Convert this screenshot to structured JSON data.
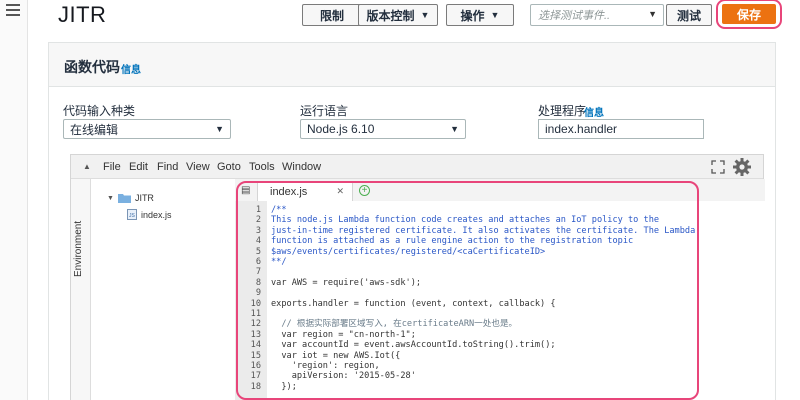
{
  "header": {
    "title": "JITR",
    "throttle_label": "限制",
    "version_label": "版本控制",
    "actions_label": "操作",
    "test_placeholder": "选择测试事件..",
    "test_label": "测试",
    "save_label": "保存"
  },
  "panel": {
    "title": "函数代码",
    "info": "信息",
    "code_entry": {
      "label": "代码输入种类",
      "value": "在线编辑"
    },
    "runtime": {
      "label": "运行语言",
      "value": "Node.js 6.10"
    },
    "handler": {
      "label": "处理程序",
      "info": "信息",
      "value": "index.handler"
    }
  },
  "ide": {
    "menu": [
      "File",
      "Edit",
      "Find",
      "View",
      "Goto",
      "Tools",
      "Window"
    ],
    "environment_label": "Environment",
    "tree": {
      "folder": "JITR",
      "file": "index.js"
    },
    "tab": "index.js",
    "code": [
      {
        "n": "1",
        "t": "/**",
        "c": "#2a57c7"
      },
      {
        "n": "2",
        "t": "This node.js Lambda function code creates and attaches an IoT policy to the",
        "c": "#2a57c7"
      },
      {
        "n": "3",
        "t": "just-in-time registered certificate. It also activates the certificate. The Lambda",
        "c": "#2a57c7"
      },
      {
        "n": "4",
        "t": "function is attached as a rule engine action to the registration topic",
        "c": "#2a57c7"
      },
      {
        "n": "5",
        "t": "$aws/events/certificates/registered/<caCertificateID>",
        "c": "#2a57c7"
      },
      {
        "n": "6",
        "t": "**/",
        "c": "#2a57c7"
      },
      {
        "n": "7",
        "t": "",
        "c": "#333333"
      },
      {
        "n": "8",
        "t": "var AWS = require('aws-sdk');",
        "c": "#333333"
      },
      {
        "n": "9",
        "t": "",
        "c": "#333333"
      },
      {
        "n": "10",
        "t": "exports.handler = function (event, context, callback) {",
        "c": "#333333"
      },
      {
        "n": "11",
        "t": "",
        "c": "#333333"
      },
      {
        "n": "12",
        "t": "  // 根据实际部署区域写入, 在certificateARN一处也是。",
        "c": "#6a7c8a"
      },
      {
        "n": "13",
        "t": "  var region = \"cn-north-1\";",
        "c": "#333333"
      },
      {
        "n": "14",
        "t": "  var accountId = event.awsAccountId.toString().trim();",
        "c": "#333333"
      },
      {
        "n": "15",
        "t": "  var iot = new AWS.Iot({",
        "c": "#333333"
      },
      {
        "n": "16",
        "t": "    'region': region,",
        "c": "#333333"
      },
      {
        "n": "17",
        "t": "    apiVersion: '2015-05-28'",
        "c": "#333333"
      },
      {
        "n": "18",
        "t": "  });",
        "c": "#333333"
      }
    ]
  },
  "colors": {
    "accent": "#ec7211",
    "highlight": "#e8457a",
    "link": "#0073bb"
  }
}
